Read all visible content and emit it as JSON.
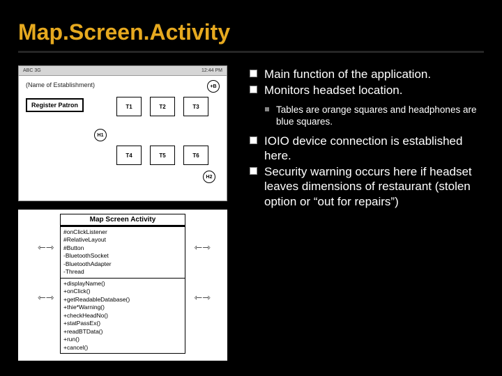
{
  "title": "Map.Screen.Activity",
  "mockup": {
    "status_left": "ABC 3G",
    "status_right": "12:44 PM",
    "establishment_label": "(Name of Establishment)",
    "register_button": "Register Patron",
    "circles": {
      "b": "+B",
      "h1": "H1",
      "h2": "H2"
    },
    "cells": {
      "t1": "T1",
      "t2": "T2",
      "t3": "T3",
      "t4": "T4",
      "t5": "T5",
      "t6": "T6"
    }
  },
  "uml": {
    "class_name": "Map Screen Activity",
    "attrs": [
      "#onClickListener",
      "#RelativeLayout",
      "#Button",
      "-BluetoothSocket",
      "-BluetoothAdapter",
      "-Thread"
    ],
    "ops": [
      "+displayName()",
      "+onClick()",
      "+getReadableDatabase()",
      "+thie*Warning()",
      "+checkHeadNo()",
      "+statPassEx()",
      "+readBTData()",
      "+run()",
      "+cancel()"
    ]
  },
  "bullets": {
    "b1": "Main function of the application.",
    "b2": "Monitors headset location.",
    "sub1": "Tables are orange squares and headphones are blue squares.",
    "b3": "IOIO device connection is established here.",
    "b4": "Security warning occurs here if headset leaves dimensions of restaurant (stolen option or “out for repairs”)"
  }
}
